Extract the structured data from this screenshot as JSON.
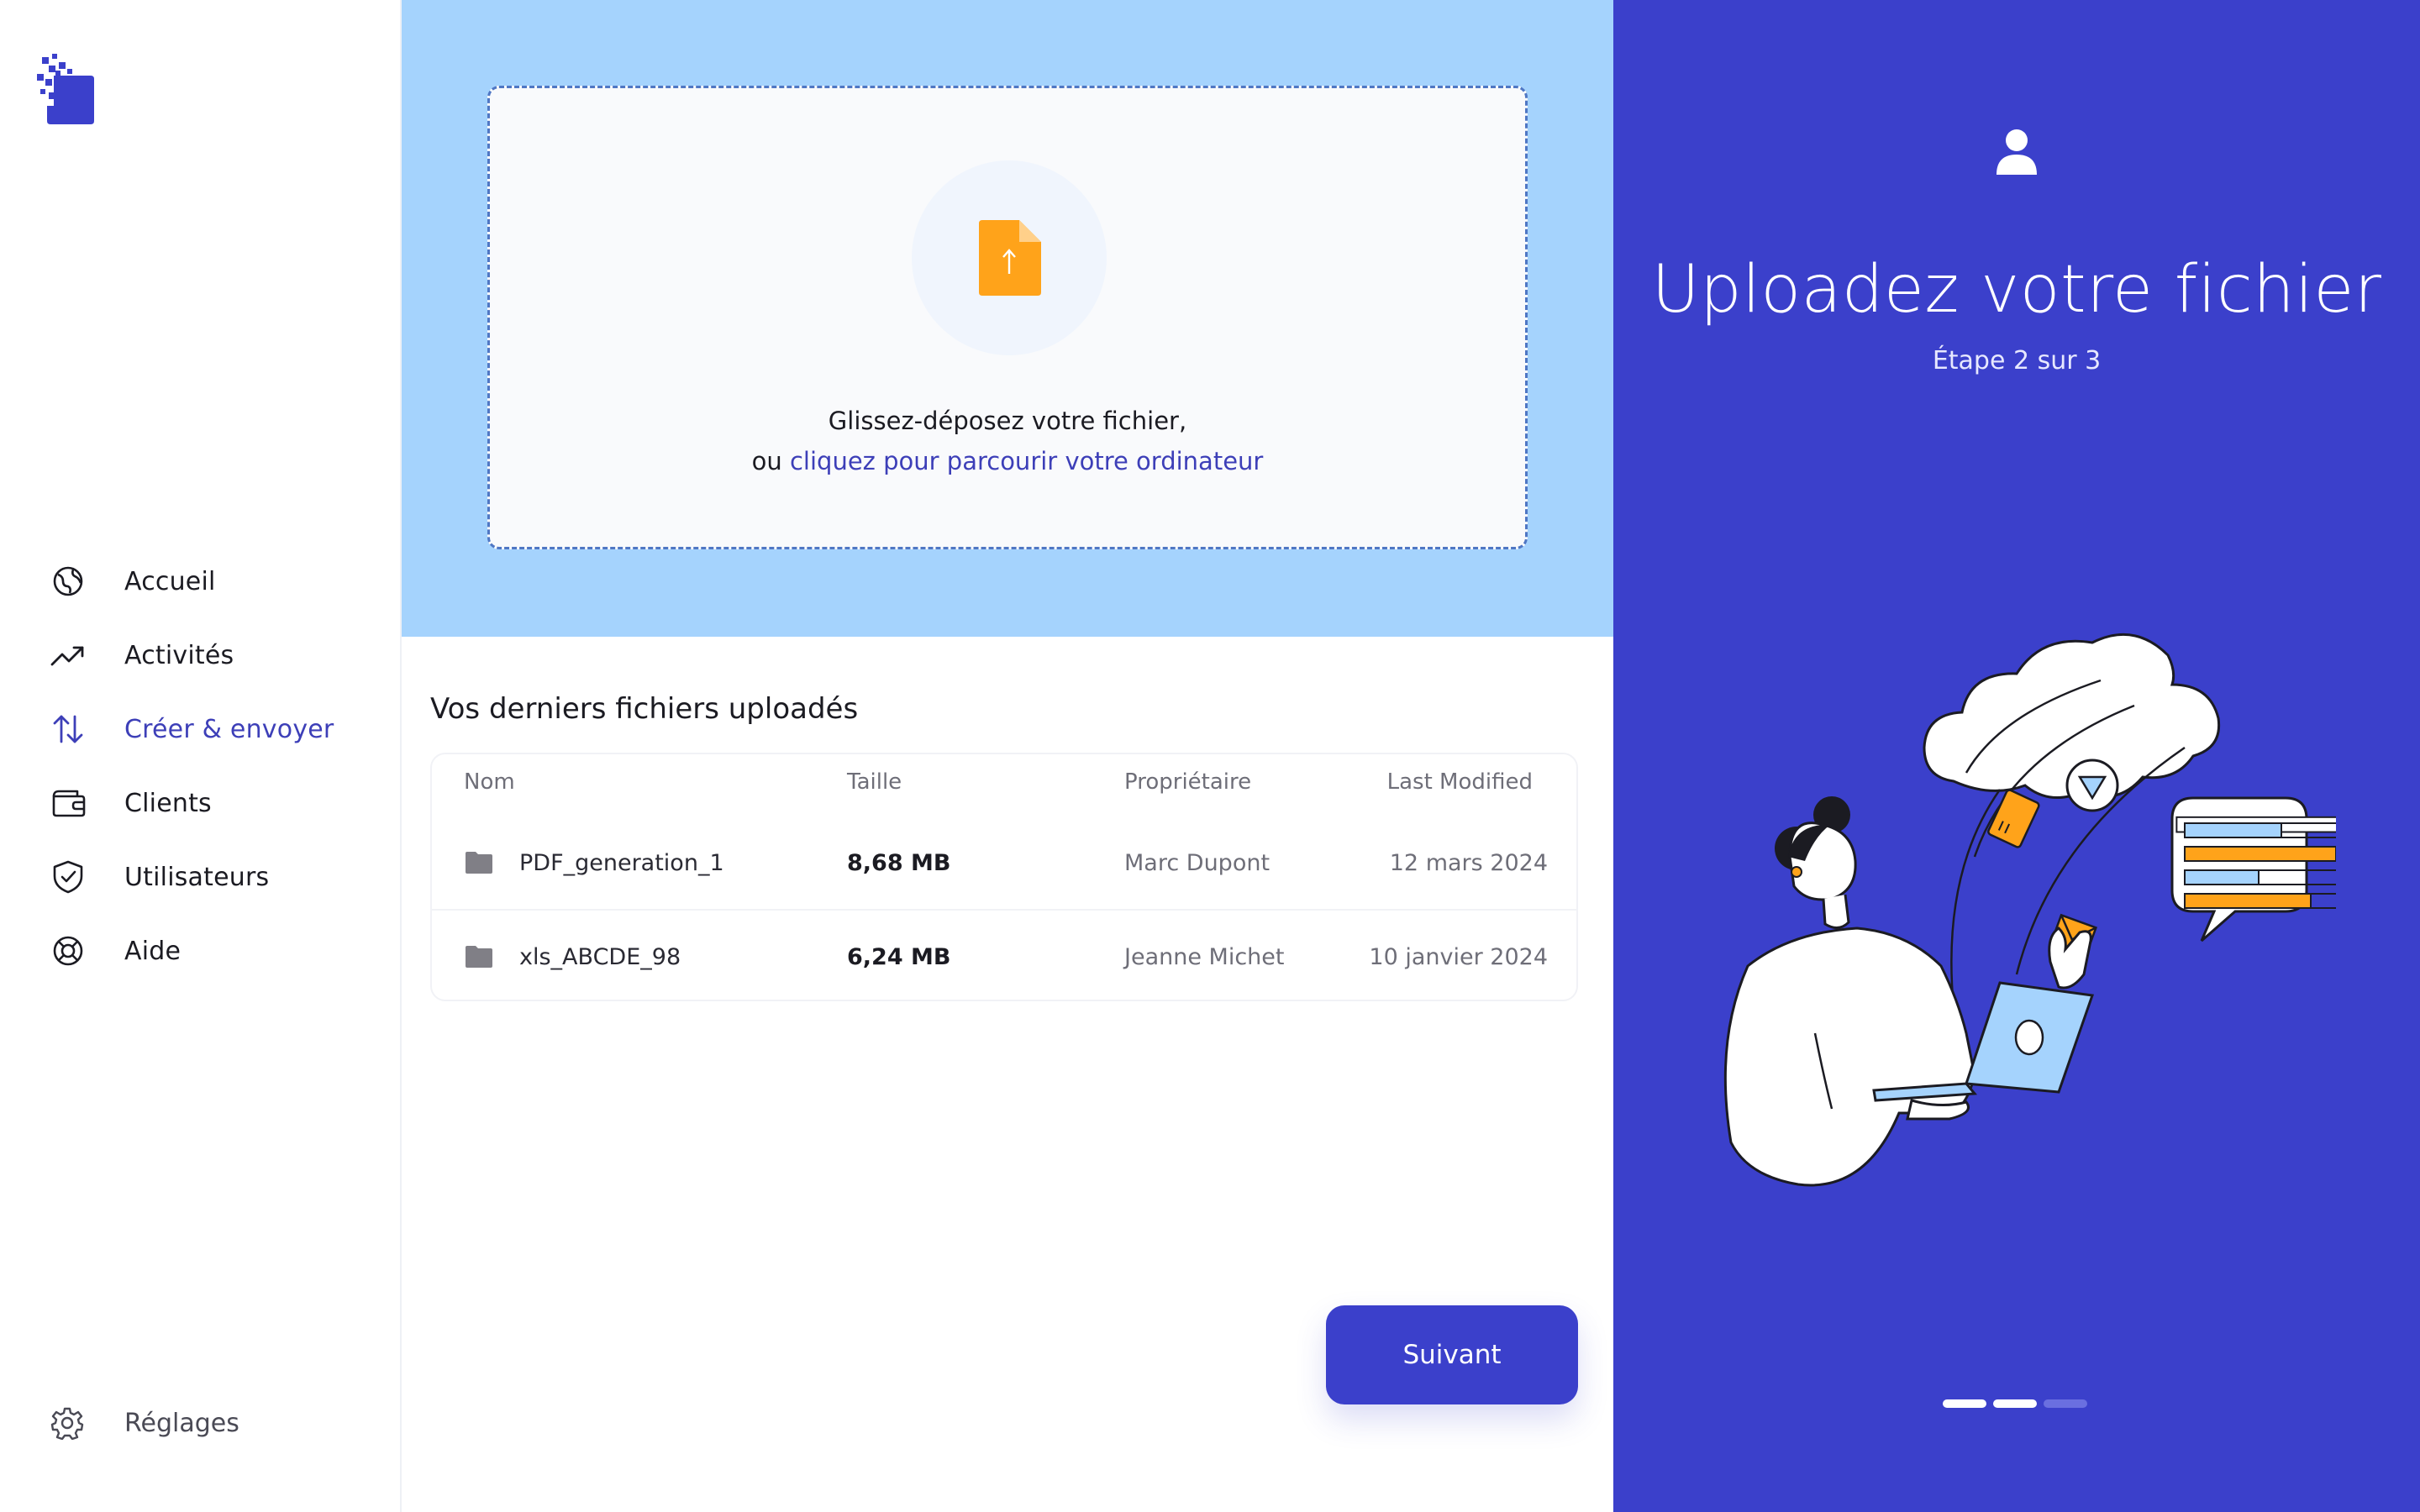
{
  "sidebar": {
    "items": [
      {
        "label": "Accueil",
        "icon": "globe-icon",
        "active": false
      },
      {
        "label": "Activités",
        "icon": "trend-up-icon",
        "active": false
      },
      {
        "label": "Créer & envoyer",
        "icon": "arrows-up-down-icon",
        "active": true
      },
      {
        "label": "Clients",
        "icon": "wallet-icon",
        "active": false
      },
      {
        "label": "Utilisateurs",
        "icon": "shield-icon",
        "active": false
      },
      {
        "label": "Aide",
        "icon": "help-wheel-icon",
        "active": false
      }
    ],
    "settings_label": "Réglages"
  },
  "upload": {
    "line1": "Glissez-déposez votre fichier,",
    "line2_prefix": "ou ",
    "line2_link": "cliquez pour parcourir votre ordinateur"
  },
  "files": {
    "title": "Vos derniers fichiers uploadés",
    "columns": {
      "name": "Nom",
      "size": "Taille",
      "owner": "Propriétaire",
      "modified": "Last Modified"
    },
    "rows": [
      {
        "name": "PDF_generation_1",
        "size": "8,68 MB",
        "owner": "Marc Dupont",
        "modified": "12 mars 2024"
      },
      {
        "name": "xls_ABCDE_98",
        "size": "6,24 MB",
        "owner": "Jeanne Michet",
        "modified": "10 janvier 2024"
      }
    ]
  },
  "next_button": "Suivant",
  "panel": {
    "title": "Uploadez votre fichier",
    "step": "Étape 2 sur 3",
    "current_step": 2,
    "total_steps": 3
  },
  "colors": {
    "accent": "#3b40cb",
    "upload_bg": "#a5d3fd",
    "file_icon": "#ffa31a",
    "link": "#3d3fb8"
  }
}
